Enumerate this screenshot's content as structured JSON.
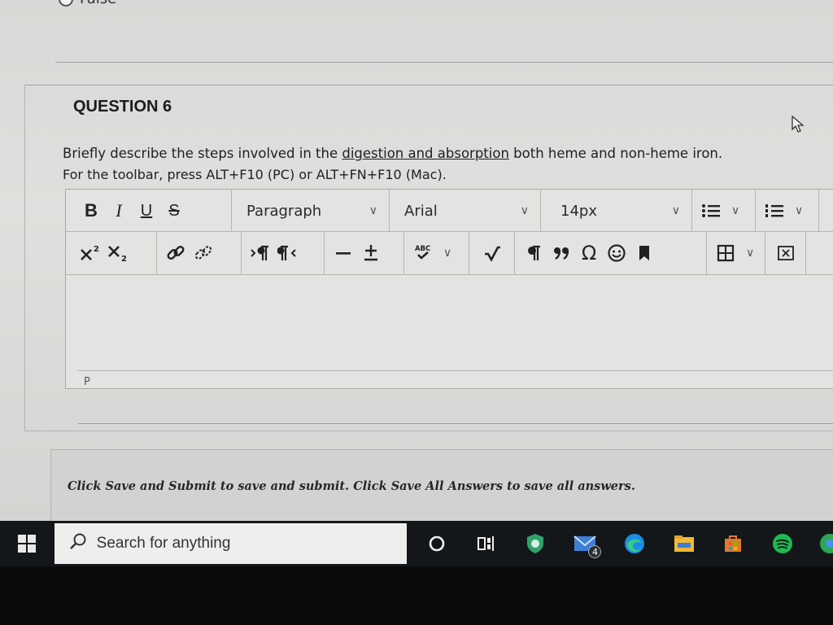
{
  "previous_question": {
    "option_label": "False"
  },
  "question": {
    "title": "QUESTION 6",
    "text_before": "Briefly describe the steps involved in the ",
    "text_link": "digestion and absorption",
    "text_after": " both heme and non-heme iron.",
    "toolbar_hint": "For the toolbar, press ALT+F10 (PC) or ALT+FN+F10 (Mac)."
  },
  "editor": {
    "row1": {
      "bold": "B",
      "italic": "I",
      "underline": "U",
      "strike": "S",
      "block_format": "Paragraph",
      "font_family": "Arial",
      "font_size": "14px"
    },
    "row2": {
      "spellcheck_label": "ABC"
    },
    "status_path": "P",
    "content": ""
  },
  "save_notice": "Click Save and Submit to save and submit. Click Save All Answers to save all answers.",
  "taskbar": {
    "search_placeholder": "Search for anything",
    "mail_badge": "4"
  },
  "colors": {
    "taskbar": "#14171a",
    "edge_blue": "#1a8fe3",
    "spotify_green": "#1db954",
    "defender_green": "#2fa36b",
    "store_orange": "#e07a2c"
  }
}
